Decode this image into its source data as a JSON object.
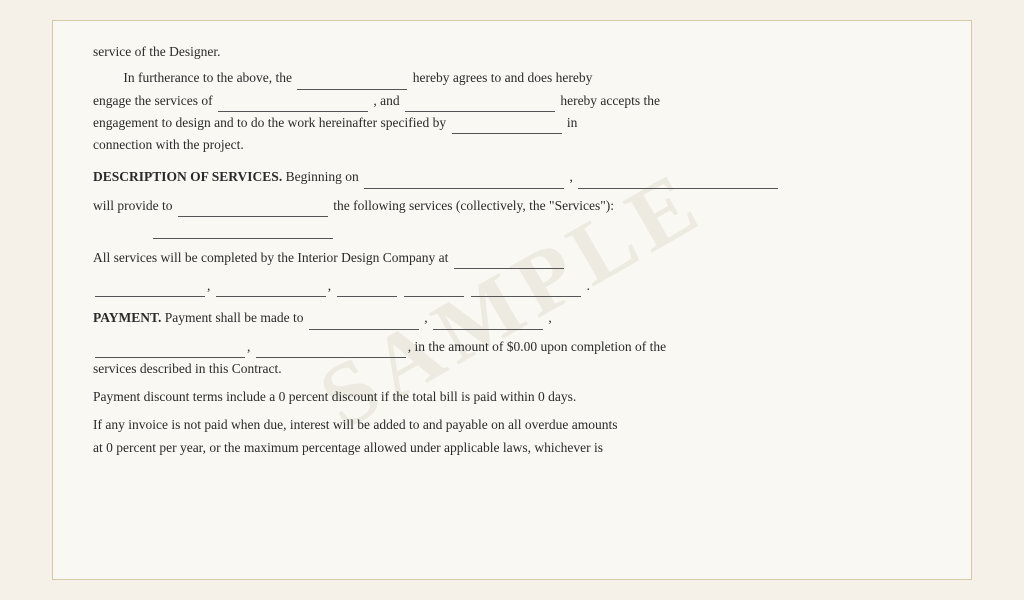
{
  "document": {
    "top_line": "service of the Designer.",
    "para1_prefix": "In furtherance to the above, the",
    "para1_mid1": "hereby agrees to and does hereby",
    "para1_engage": "engage the services of",
    "para1_and": ", and",
    "para1_accepts": "hereby accepts the",
    "para1_engagement": "engagement to design and to do the work hereinafter specified by",
    "para1_in": "in",
    "para1_connection": "connection with the project.",
    "section2_header": "DESCRIPTION OF SERVICES.",
    "section2_beginning": "Beginning on",
    "section2_comma": ",",
    "section2_will": "will provide to",
    "section2_services": "the following services (collectively, the \"Services\"):",
    "all_services": "All services will be completed by the Interior Design Company at",
    "address_period": ".",
    "payment_header": "PAYMENT.",
    "payment_text": "Payment shall be made to",
    "payment_comma1": ",",
    "payment_comma2": ",",
    "payment_amount": "in the amount of $0.00 upon completion of the",
    "payment_services": "services described in this Contract.",
    "discount_text": "Payment discount terms include a 0 percent discount if the total bill is paid within 0 days.",
    "interest_text": "If any invoice is not paid when due, interest will be added to and payable on all overdue amounts",
    "interest_text2": "at 0 percent per year, or the maximum percentage allowed under applicable laws, whichever is"
  }
}
